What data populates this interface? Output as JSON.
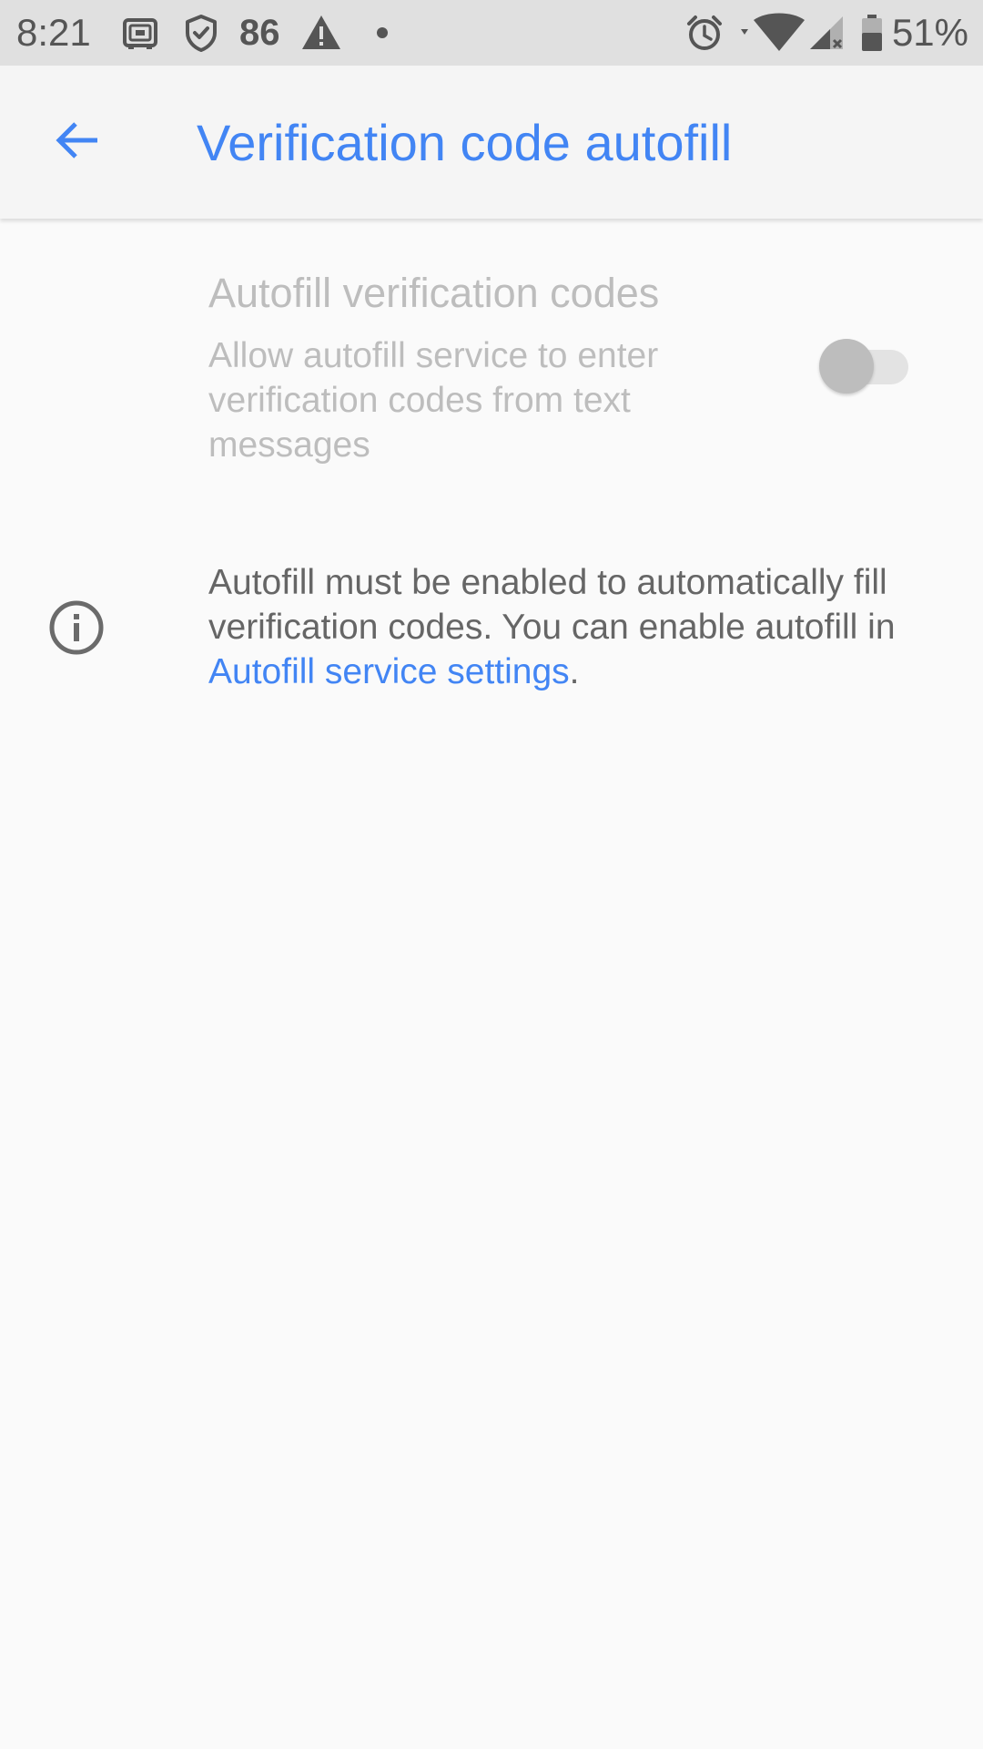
{
  "status_bar": {
    "time": "8:21",
    "notification_count": "86",
    "battery_percent": "51%",
    "icons": [
      "cast-icon",
      "shield-icon",
      "warning-icon",
      "dot-icon",
      "alarm-icon",
      "wifi-icon",
      "signal-icon",
      "battery-icon"
    ]
  },
  "app_bar": {
    "back_icon": "arrow-back-icon",
    "title": "Verification code autofill"
  },
  "preference": {
    "title": "Autofill verification codes",
    "summary": "Allow autofill service to enter verification codes from text messages",
    "toggle_checked": false,
    "enabled": false
  },
  "info": {
    "icon": "info-icon",
    "text_before_link": "Autofill must be enabled to automatically fill verification codes. You can enable autofill in ",
    "link_text": "Autofill service settings",
    "text_after_link": "."
  },
  "colors": {
    "accent": "#4285f4",
    "status_bar_bg": "#e0e0e0",
    "background": "#fafafa",
    "disabled_text": "#bdbdbd",
    "body_text": "#666666"
  }
}
